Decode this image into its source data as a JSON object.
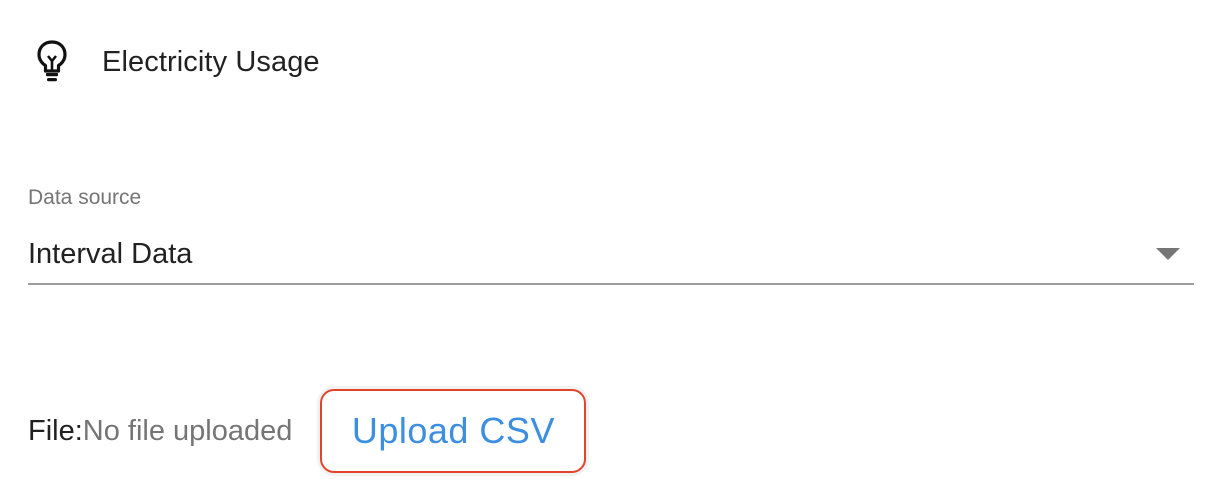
{
  "header": {
    "icon": "lightbulb-icon",
    "title": "Electricity Usage"
  },
  "data_source": {
    "label": "Data source",
    "selected_value": "Interval Data"
  },
  "file": {
    "label": "File:",
    "status": "No file uploaded",
    "upload_button_label": "Upload CSV"
  },
  "colors": {
    "upload_button_text": "#3b8ee0",
    "upload_button_border": "#e0452b"
  }
}
